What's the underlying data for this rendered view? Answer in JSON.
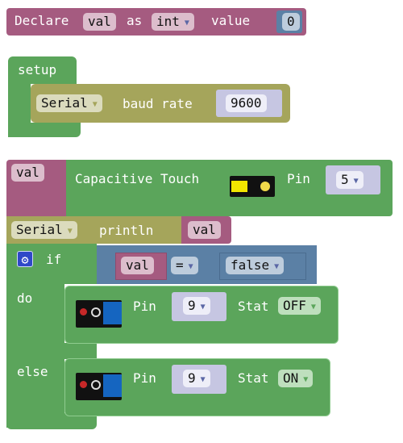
{
  "declare": {
    "label": "Declare",
    "var": "val",
    "as": "as",
    "type": "int",
    "value_label": "value",
    "value": "0"
  },
  "setup": {
    "label": "setup",
    "serial": "Serial",
    "baud_label": "baud rate",
    "baud": "9600"
  },
  "touch": {
    "var": "val",
    "label": "Capacitive Touch",
    "pin_label": "Pin",
    "pin": "5"
  },
  "println": {
    "serial": "Serial",
    "label": "println",
    "var": "val"
  },
  "if_block": {
    "if_label": "if",
    "var": "val",
    "op": "=",
    "value": "false",
    "do_label": "do",
    "else_label": "else"
  },
  "do_led": {
    "pin_label": "Pin",
    "pin": "9",
    "stat_label": "Stat",
    "stat": "OFF"
  },
  "else_led": {
    "pin_label": "Pin",
    "pin": "9",
    "stat_label": "Stat",
    "stat": "ON"
  },
  "colors": {
    "variable": "#a55b80",
    "logic": "#5b80a5",
    "control": "#5ba55b",
    "serial": "#a5a55b"
  }
}
